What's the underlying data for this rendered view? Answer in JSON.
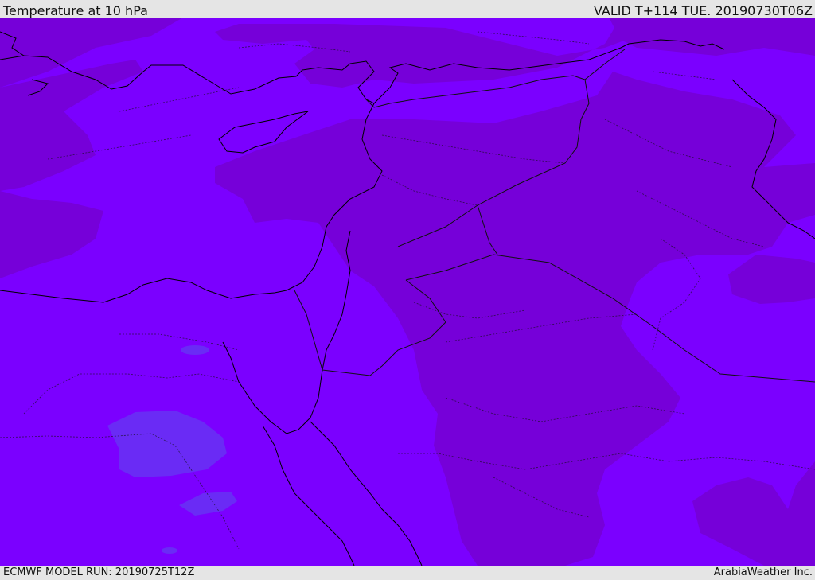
{
  "header": {
    "title": "Temperature at 10 hPa",
    "valid_time": "VALID T+114 TUE. 20190730T06Z"
  },
  "footer": {
    "model_run": "ECMWF MODEL RUN: 20190725T12Z",
    "credit": "ArabiaWeather Inc."
  },
  "map": {
    "variable": "temperature",
    "pressure_level": "10 hPa",
    "region": "Eastern Mediterranean, Egypt, Levant, Turkey, Iraq and northern Saudi Arabia",
    "colors": {
      "base_band": "#7b00ff",
      "darker_band": "#7600d9",
      "cooler_patch": "#6a2bf5",
      "coast_line": "#000000",
      "border_line": "#111111"
    }
  }
}
